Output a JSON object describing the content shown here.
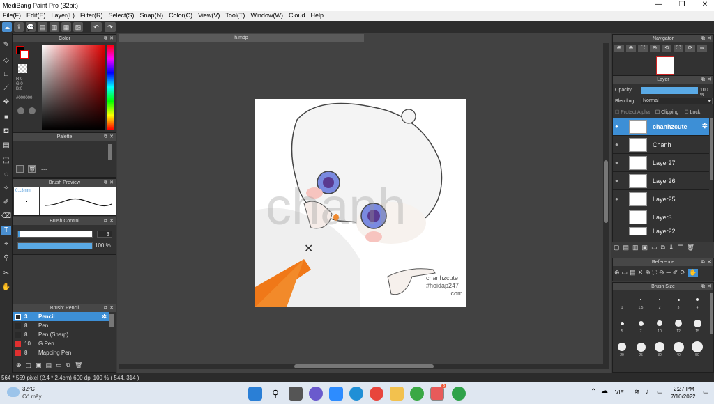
{
  "app": {
    "title": "MediBang Paint Pro (32bit)"
  },
  "menu": [
    "File(F)",
    "Edit(E)",
    "Layer(L)",
    "Filter(R)",
    "Select(S)",
    "Snap(N)",
    "Color(C)",
    "View(V)",
    "Tool(T)",
    "Window(W)",
    "Cloud",
    "Help"
  ],
  "document": {
    "tab": "h.mdp"
  },
  "color_panel": {
    "title": "Color",
    "r": "R:0",
    "g": "G:0",
    "b": "B:0",
    "hex": "#000000"
  },
  "palette_panel": {
    "title": "Palette",
    "dash": "---"
  },
  "brush_preview": {
    "title": "Brush Preview",
    "size": "0.13mm"
  },
  "brush_control": {
    "title": "Brush Control",
    "size_value": "3",
    "opacity_value": "100 %",
    "size_fraction": 0.03,
    "opacity_fraction": 1.0
  },
  "brush_list": {
    "title": "Brush: Pencil",
    "items": [
      {
        "size": "3",
        "name": "Pencil",
        "color": "#2a2a2a"
      },
      {
        "size": "8",
        "name": "Pen",
        "color": "#2a2a2a"
      },
      {
        "size": "8",
        "name": "Pen (Sharp)",
        "color": "#2a2a2a"
      },
      {
        "size": "10",
        "name": "G Pen",
        "color": "#e03030"
      },
      {
        "size": "8",
        "name": "Mapping Pen",
        "color": "#e03030"
      }
    ]
  },
  "navigator": {
    "title": "Navigator"
  },
  "layer_panel": {
    "title": "Layer",
    "opacity_label": "Opacity",
    "opacity_value": "100 %",
    "blending_label": "Blending",
    "blending_value": "Normal",
    "protect_alpha": "Protect Alpha",
    "clipping": "Clipping",
    "lock": "Lock",
    "layers": [
      "chanhzcute",
      "Chanh",
      "Layer27",
      "Layer26",
      "Layer25",
      "Layer3",
      "Layer22"
    ]
  },
  "reference_panel": {
    "title": "Reference"
  },
  "brush_size_panel": {
    "title": "Brush Size",
    "sizes": [
      "1",
      "1.5",
      "2",
      "3",
      "4",
      "5",
      "7",
      "10",
      "12",
      "15",
      "20",
      "25",
      "30",
      "40",
      "50"
    ]
  },
  "artwork": {
    "watermark": "chanhzcute\n#hoidap247\n.com",
    "big_watermark": "chanh"
  },
  "status": {
    "text": "564 * 559 pixel   (2.4 * 2.4cm)   600 dpi   100 %   ( 544, 314 )"
  },
  "taskbar": {
    "temp": "32°C",
    "weather": "Có mây",
    "lang": "VIE",
    "time": "2:27 PM",
    "date": "7/10/2022",
    "badge": "3"
  },
  "colors": {
    "accent": "#4a9ee0",
    "selected_row": "#3d8fd6"
  }
}
